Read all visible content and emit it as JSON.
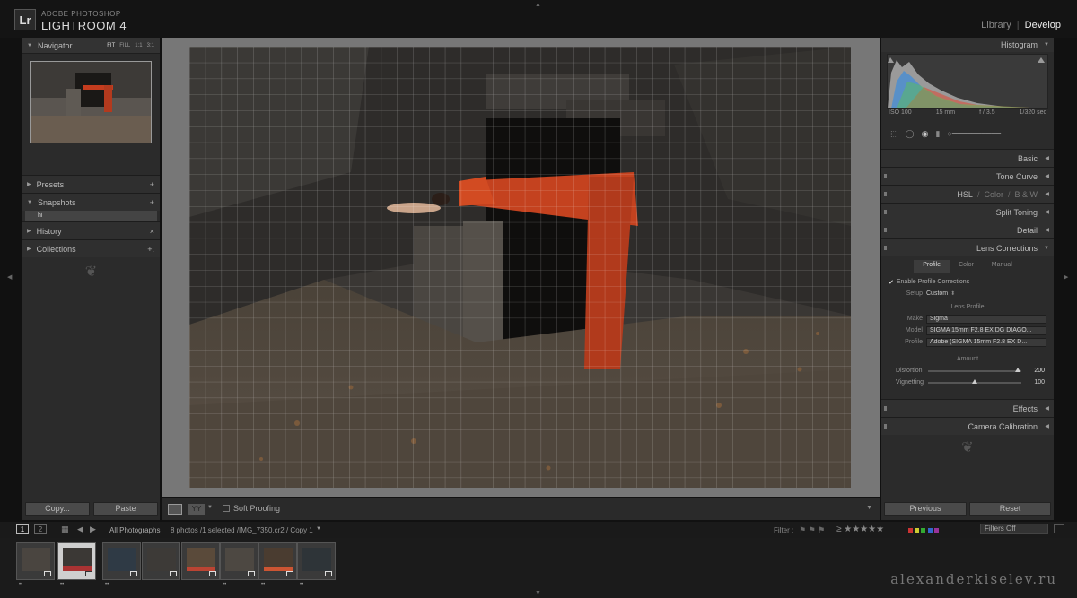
{
  "app": {
    "brand_small": "ADOBE PHOTOSHOP",
    "brand_name": "LIGHTROOM 4",
    "logo": "Lr",
    "modules": [
      "Library",
      "Develop"
    ],
    "active_module": "Develop"
  },
  "left_panel": {
    "navigator": {
      "label": "Navigator",
      "zoom_options": [
        "FIT",
        "FILL",
        "1:1",
        "3:1"
      ],
      "zoom_active": "FIT"
    },
    "presets": {
      "label": "Presets"
    },
    "snapshots": {
      "label": "Snapshots",
      "items": [
        "hi"
      ]
    },
    "history": {
      "label": "History"
    },
    "collections": {
      "label": "Collections"
    },
    "copy_button": "Copy...",
    "paste_button": "Paste"
  },
  "toolbar": {
    "soft_proofing": "Soft Proofing"
  },
  "right_panel": {
    "histogram": {
      "label": "Histogram",
      "iso": "ISO 100",
      "focal": "15 mm",
      "aperture": "f / 3.5",
      "shutter": "1/320 sec"
    },
    "sections": [
      "Basic",
      "Tone Curve",
      "HSL / Color / B & W",
      "Split Toning",
      "Detail",
      "Lens Corrections",
      "Effects",
      "Camera Calibration"
    ],
    "basic": "Basic",
    "tone_curve": "Tone Curve",
    "hsl": {
      "hsl": "HSL",
      "color": "Color",
      "bw": "B & W"
    },
    "split_toning": "Split Toning",
    "detail": "Detail",
    "lens_corrections": {
      "label": "Lens Corrections",
      "tabs": [
        "Profile",
        "Color",
        "Manual"
      ],
      "active_tab": "Profile",
      "enable_profile": "Enable Profile Corrections",
      "setup_label": "Setup",
      "setup_value": "Custom",
      "lens_profile_heading": "Lens Profile",
      "make_label": "Make",
      "make_value": "Sigma",
      "model_label": "Model",
      "model_value": "SIGMA 15mm F2.8 EX DG DIAGO...",
      "profile_label": "Profile",
      "profile_value": "Adobe (SIGMA 15mm F2.8 EX D...",
      "amount_heading": "Amount",
      "distortion_label": "Distortion",
      "distortion_value": "200",
      "distortion_fraction": 0.96,
      "vignetting_label": "Vignetting",
      "vignetting_value": "100",
      "vignetting_fraction": 0.5
    },
    "effects": "Effects",
    "camera_calibration": "Camera Calibration",
    "previous_button": "Previous",
    "reset_button": "Reset"
  },
  "filmstrip": {
    "view1": "1",
    "view2": "2",
    "source": "All Photographs",
    "status": "8 photos /1 selected /IMG_7350.cr2 / Copy 1",
    "filter_label": "Filter :",
    "filter_preset": "Filters Off",
    "thumb_count": 8,
    "selected_index": 1
  },
  "watermark": "alexanderkiselev.ru"
}
